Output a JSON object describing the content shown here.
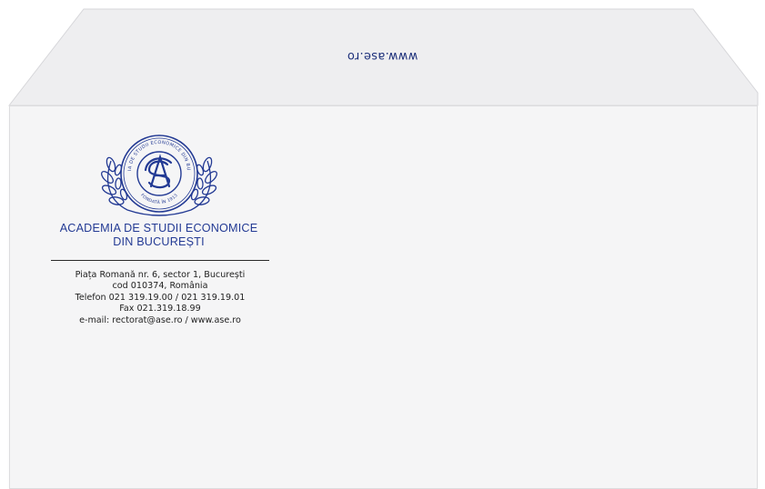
{
  "flap": {
    "url_text": "www.ase.ro"
  },
  "logo": {
    "crest_text_ring": "ACADEMIA DE STUDII ECONOMICE DIN BUCUREȘTI",
    "crest_founded": "FONDATĂ ÎN 1913",
    "institution_line1": "ACADEMIA DE STUDII ECONOMICE",
    "institution_line2": "DIN BUCUREȘTI"
  },
  "address": {
    "line1": "Piața Romană nr. 6, sector 1, București",
    "line2": "cod 010374, România",
    "line3": "Telefon 021 319.19.00 / 021 319.19.01",
    "line4": "Fax 021.319.18.99",
    "line5": "e-mail: rectorat@ase.ro / www.ase.ro"
  },
  "colors": {
    "brand_blue": "#233a94",
    "envelope": "#f5f5f6",
    "flap": "#ededef",
    "text": "#222222"
  }
}
